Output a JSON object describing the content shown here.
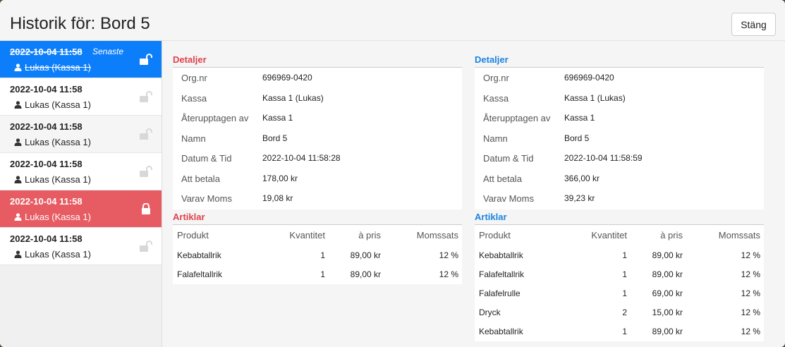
{
  "window": {
    "title": "Historik för: Bord 5",
    "close_label": "Stäng"
  },
  "history": [
    {
      "date": "2022-10-04 11:58",
      "user": "Lukas (Kassa 1)",
      "badge": "Senaste",
      "state": "blue",
      "strike": true
    },
    {
      "date": "2022-10-04 11:58",
      "user": "Lukas (Kassa 1)",
      "badge": "",
      "state": "normal",
      "strike": false
    },
    {
      "date": "2022-10-04 11:58",
      "user": "Lukas (Kassa 1)",
      "badge": "",
      "state": "alt",
      "strike": false
    },
    {
      "date": "2022-10-04 11:58",
      "user": "Lukas (Kassa 1)",
      "badge": "",
      "state": "normal",
      "strike": false
    },
    {
      "date": "2022-10-04 11:58",
      "user": "Lukas (Kassa 1)",
      "badge": "",
      "state": "red",
      "strike": false
    },
    {
      "date": "2022-10-04 11:58",
      "user": "Lukas (Kassa 1)",
      "badge": "",
      "state": "normal",
      "strike": false
    }
  ],
  "left": {
    "details_title": "Detaljer",
    "articles_title": "Artiklar",
    "details": [
      {
        "label": "Org.nr",
        "value": "696969-0420"
      },
      {
        "label": "Kassa",
        "value": "Kassa 1 (Lukas)"
      },
      {
        "label": "Återupptagen av",
        "value": "Kassa 1"
      },
      {
        "label": "Namn",
        "value": "Bord 5"
      },
      {
        "label": "Datum & Tid",
        "value": "2022-10-04 11:58:28"
      },
      {
        "label": "Att betala",
        "value": "178,00 kr"
      },
      {
        "label": "Varav Moms",
        "value": "19,08 kr"
      }
    ],
    "columns": [
      "Produkt",
      "Kvantitet",
      "à pris",
      "Momssats"
    ],
    "rows": [
      [
        "Kebabtallrik",
        "1",
        "89,00 kr",
        "12 %"
      ],
      [
        "Falafeltallrik",
        "1",
        "89,00 kr",
        "12 %"
      ]
    ]
  },
  "right": {
    "details_title": "Detaljer",
    "articles_title": "Artiklar",
    "details": [
      {
        "label": "Org.nr",
        "value": "696969-0420"
      },
      {
        "label": "Kassa",
        "value": "Kassa 1 (Lukas)"
      },
      {
        "label": "Återupptagen av",
        "value": "Kassa 1"
      },
      {
        "label": "Namn",
        "value": "Bord 5"
      },
      {
        "label": "Datum & Tid",
        "value": "2022-10-04 11:58:59"
      },
      {
        "label": "Att betala",
        "value": "366,00 kr"
      },
      {
        "label": "Varav Moms",
        "value": "39,23 kr"
      }
    ],
    "columns": [
      "Produkt",
      "Kvantitet",
      "à pris",
      "Momssats"
    ],
    "rows": [
      [
        "Kebabtallrik",
        "1",
        "89,00 kr",
        "12 %"
      ],
      [
        "Falafeltallrik",
        "1",
        "89,00 kr",
        "12 %"
      ],
      [
        "Falafelrulle",
        "1",
        "69,00 kr",
        "12 %"
      ],
      [
        "Dryck",
        "2",
        "15,00 kr",
        "12 %"
      ],
      [
        "Kebabtallrik",
        "1",
        "89,00 kr",
        "12 %"
      ]
    ]
  },
  "colors": {
    "blue": "#0d7ef9",
    "red": "#e75c63",
    "red_title": "#e0424c",
    "blue_title": "#1c84e0"
  }
}
